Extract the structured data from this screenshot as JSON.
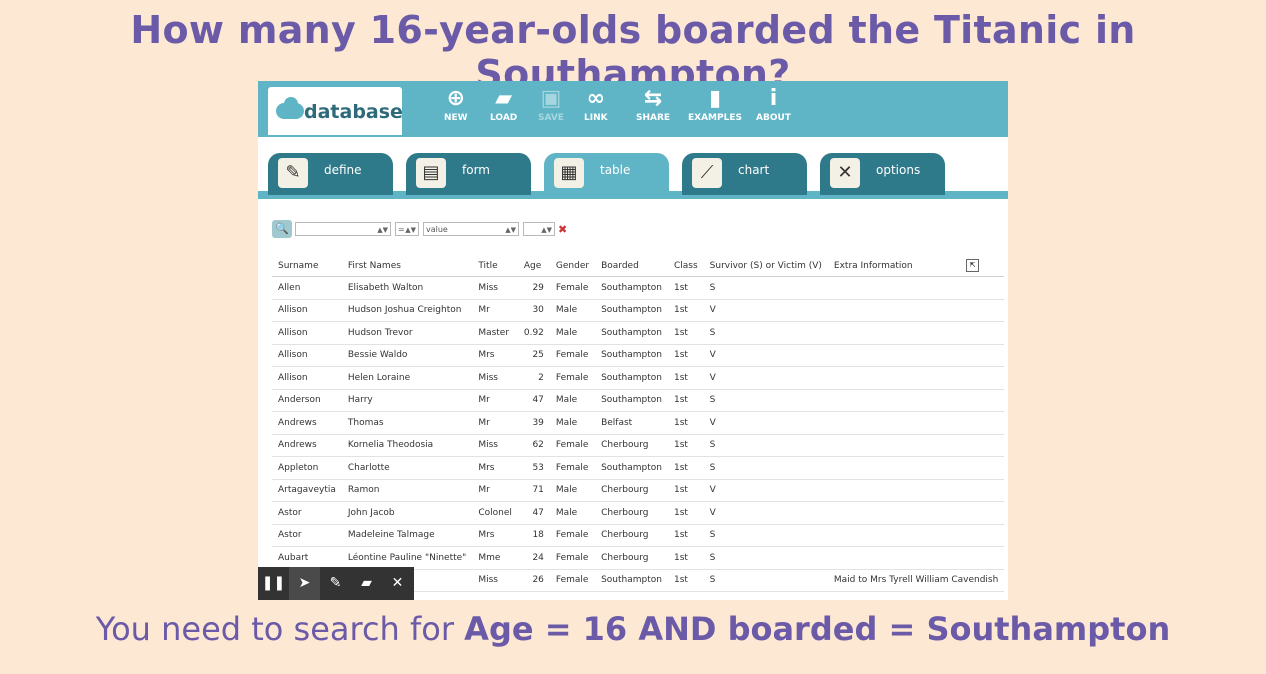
{
  "heading": "How many 16-year-olds boarded the Titanic in Southampton?",
  "footer": {
    "prefix": "You need to search for ",
    "query": "Age = 16 AND boarded = Southampton"
  },
  "app": {
    "logo_text": "database",
    "toolbar": [
      {
        "label": "NEW",
        "icon": "plus-circle-icon",
        "glyph": "⊕",
        "disabled": false
      },
      {
        "label": "LOAD",
        "icon": "folder-icon",
        "glyph": "▰",
        "disabled": false
      },
      {
        "label": "SAVE",
        "icon": "floppy-icon",
        "glyph": "▣",
        "disabled": true
      },
      {
        "label": "LINK",
        "icon": "chain-link-icon",
        "glyph": "∞",
        "disabled": false
      },
      {
        "label": "SHARE",
        "icon": "share-icon",
        "glyph": "⇆",
        "disabled": false
      },
      {
        "label": "EXAMPLES",
        "icon": "bookmark-icon",
        "glyph": "▮",
        "disabled": false
      },
      {
        "label": "ABOUT",
        "icon": "info-icon",
        "glyph": "i",
        "disabled": false
      }
    ],
    "tabs": [
      {
        "label": "define",
        "icon": "pencil-icon",
        "glyph": "✎",
        "active": false
      },
      {
        "label": "form",
        "icon": "form-icon",
        "glyph": "▤",
        "active": false
      },
      {
        "label": "table",
        "icon": "table-icon",
        "glyph": "▦",
        "active": true
      },
      {
        "label": "chart",
        "icon": "line-chart-icon",
        "glyph": "⟋",
        "active": false
      },
      {
        "label": "options",
        "icon": "tools-icon",
        "glyph": "✕",
        "active": false
      }
    ],
    "filter": {
      "field": "",
      "operator": "=",
      "value_placeholder": "value",
      "extra": ""
    },
    "table": {
      "columns": [
        "Surname",
        "First Names",
        "Title",
        "Age",
        "Gender",
        "Boarded",
        "Class",
        "Survivor (S) or Victim (V)",
        "Extra Information"
      ],
      "rows": [
        [
          "Allen",
          "Elisabeth Walton",
          "Miss",
          "29",
          "Female",
          "Southampton",
          "1st",
          "S",
          ""
        ],
        [
          "Allison",
          "Hudson Joshua Creighton",
          "Mr",
          "30",
          "Male",
          "Southampton",
          "1st",
          "V",
          ""
        ],
        [
          "Allison",
          "Hudson Trevor",
          "Master",
          "0.92",
          "Male",
          "Southampton",
          "1st",
          "S",
          ""
        ],
        [
          "Allison",
          "Bessie Waldo",
          "Mrs",
          "25",
          "Female",
          "Southampton",
          "1st",
          "V",
          ""
        ],
        [
          "Allison",
          "Helen Loraine",
          "Miss",
          "2",
          "Female",
          "Southampton",
          "1st",
          "V",
          ""
        ],
        [
          "Anderson",
          "Harry",
          "Mr",
          "47",
          "Male",
          "Southampton",
          "1st",
          "S",
          ""
        ],
        [
          "Andrews",
          "Thomas",
          "Mr",
          "39",
          "Male",
          "Belfast",
          "1st",
          "V",
          ""
        ],
        [
          "Andrews",
          "Kornelia Theodosia",
          "Miss",
          "62",
          "Female",
          "Cherbourg",
          "1st",
          "S",
          ""
        ],
        [
          "Appleton",
          "Charlotte",
          "Mrs",
          "53",
          "Female",
          "Southampton",
          "1st",
          "S",
          ""
        ],
        [
          "Artagaveytia",
          "Ramon",
          "Mr",
          "71",
          "Male",
          "Cherbourg",
          "1st",
          "V",
          ""
        ],
        [
          "Astor",
          "John Jacob",
          "Colonel",
          "47",
          "Male",
          "Cherbourg",
          "1st",
          "V",
          ""
        ],
        [
          "Astor",
          "Madeleine Talmage",
          "Mrs",
          "18",
          "Female",
          "Cherbourg",
          "1st",
          "S",
          ""
        ],
        [
          "Aubart",
          "Léontine Pauline \"Ninette\"",
          "Mme",
          "24",
          "Female",
          "Cherbourg",
          "1st",
          "S",
          ""
        ],
        [
          "",
          "",
          "Miss",
          "26",
          "Female",
          "Southampton",
          "1st",
          "S",
          "Maid to Mrs Tyrell William Cavendish"
        ]
      ]
    },
    "recorder": [
      {
        "icon": "pause-icon",
        "glyph": "❚❚"
      },
      {
        "icon": "cursor-icon",
        "glyph": "➤"
      },
      {
        "icon": "pen-icon",
        "glyph": "✎"
      },
      {
        "icon": "eraser-icon",
        "glyph": "▰"
      },
      {
        "icon": "close-icon",
        "glyph": "✕"
      }
    ]
  }
}
